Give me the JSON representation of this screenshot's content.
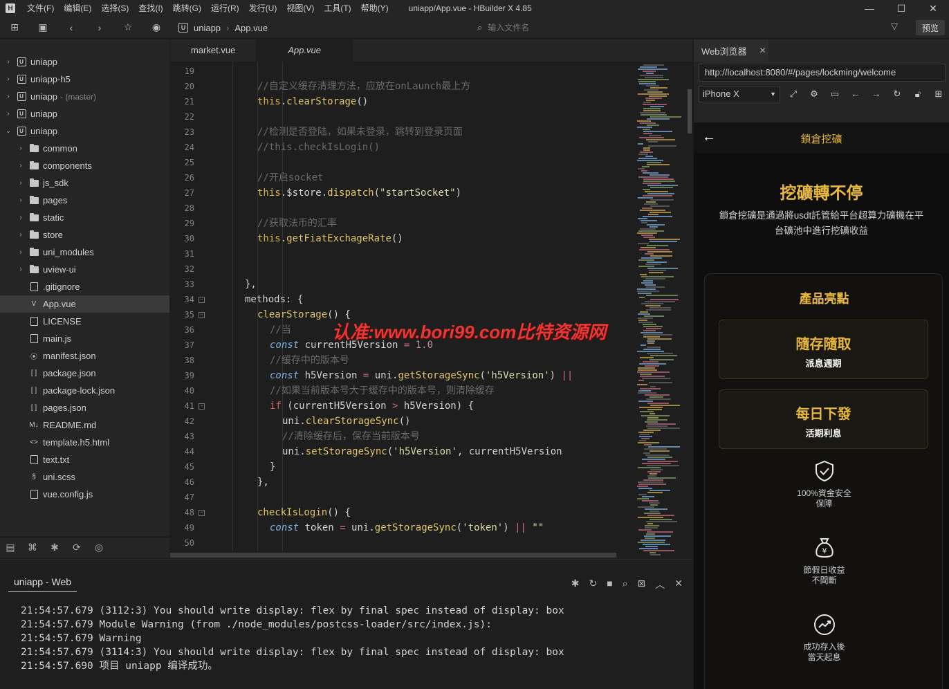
{
  "titlebar": {
    "menus": [
      "文件(F)",
      "编辑(E)",
      "选择(S)",
      "查找(I)",
      "跳转(G)",
      "运行(R)",
      "发行(U)",
      "视图(V)",
      "工具(T)",
      "帮助(Y)"
    ],
    "title": "uniapp/App.vue - HBuilder X 4.85"
  },
  "toolbar": {
    "breadcrumb": [
      "uniapp",
      "App.vue"
    ],
    "file_search_placeholder": "输入文件名",
    "preview_label": "预览"
  },
  "sidebar": {
    "projects": [
      {
        "name": "uniapp",
        "branch": ""
      },
      {
        "name": "uniapp-h5",
        "branch": ""
      },
      {
        "name": "uniapp",
        "branch": "- (master)"
      },
      {
        "name": "uniapp",
        "branch": ""
      },
      {
        "name": "uniapp",
        "branch": ""
      }
    ],
    "folders": [
      "common",
      "components",
      "js_sdk",
      "pages",
      "static",
      "store",
      "uni_modules",
      "uview-ui"
    ],
    "files": [
      ".gitignore",
      "App.vue",
      "LICENSE",
      "main.js",
      "manifest.json",
      "package.json",
      "package-lock.json",
      "pages.json",
      "README.md",
      "template.h5.html",
      "text.txt",
      "uni.scss",
      "vue.config.js"
    ],
    "selected_file": "App.vue"
  },
  "editor": {
    "tabs": [
      "market.vue",
      "App.vue"
    ],
    "active_tab": "App.vue",
    "first_line_number": 19,
    "lines": [
      {
        "indent": 0,
        "tokens": []
      },
      {
        "indent": 4,
        "tokens": [
          {
            "t": "//自定义缓存清理方法，应放在onLaunch最上方",
            "c": "c-comment"
          }
        ]
      },
      {
        "indent": 4,
        "tokens": [
          {
            "t": "this",
            "c": "c-this"
          },
          {
            "t": ".",
            "c": "c-plain"
          },
          {
            "t": "clearStorage",
            "c": "c-fn"
          },
          {
            "t": "()",
            "c": "c-plain"
          }
        ]
      },
      {
        "indent": 0,
        "tokens": []
      },
      {
        "indent": 4,
        "tokens": [
          {
            "t": "//检测是否登陆，如果未登录，跳转到登录页面",
            "c": "c-comment"
          }
        ]
      },
      {
        "indent": 4,
        "tokens": [
          {
            "t": "//this.checkIsLogin()",
            "c": "c-comment"
          }
        ]
      },
      {
        "indent": 0,
        "tokens": []
      },
      {
        "indent": 4,
        "tokens": [
          {
            "t": "//开启socket",
            "c": "c-comment"
          }
        ]
      },
      {
        "indent": 4,
        "tokens": [
          {
            "t": "this",
            "c": "c-this"
          },
          {
            "t": ".$store.",
            "c": "c-plain"
          },
          {
            "t": "dispatch",
            "c": "c-fn"
          },
          {
            "t": "(",
            "c": "c-plain"
          },
          {
            "t": "\"startSocket\"",
            "c": "c-str"
          },
          {
            "t": ")",
            "c": "c-plain"
          }
        ]
      },
      {
        "indent": 0,
        "tokens": []
      },
      {
        "indent": 4,
        "tokens": [
          {
            "t": "//获取法币的汇率",
            "c": "c-comment"
          }
        ]
      },
      {
        "indent": 4,
        "tokens": [
          {
            "t": "this",
            "c": "c-this"
          },
          {
            "t": ".",
            "c": "c-plain"
          },
          {
            "t": "getFiatExchageRate",
            "c": "c-fn"
          },
          {
            "t": "()",
            "c": "c-plain"
          }
        ]
      },
      {
        "indent": 0,
        "tokens": []
      },
      {
        "indent": 0,
        "tokens": []
      },
      {
        "indent": 2,
        "tokens": [
          {
            "t": "},",
            "c": "c-plain"
          }
        ]
      },
      {
        "indent": 2,
        "fold": true,
        "tokens": [
          {
            "t": "methods: {",
            "c": "c-plain"
          }
        ]
      },
      {
        "indent": 4,
        "fold": true,
        "tokens": [
          {
            "t": "clearStorage",
            "c": "c-fn"
          },
          {
            "t": "() {",
            "c": "c-plain"
          }
        ]
      },
      {
        "indent": 6,
        "tokens": [
          {
            "t": "//当",
            "c": "c-comment"
          }
        ]
      },
      {
        "indent": 6,
        "tokens": [
          {
            "t": "const",
            "c": "c-kw"
          },
          {
            "t": " currentH5Version ",
            "c": "c-plain"
          },
          {
            "t": "=",
            "c": "c-op"
          },
          {
            "t": " ",
            "c": "c-plain"
          },
          {
            "t": "1.0",
            "c": "c-num"
          }
        ]
      },
      {
        "indent": 6,
        "tokens": [
          {
            "t": "//缓存中的版本号",
            "c": "c-comment"
          }
        ]
      },
      {
        "indent": 6,
        "tokens": [
          {
            "t": "const",
            "c": "c-kw"
          },
          {
            "t": " h5Version ",
            "c": "c-plain"
          },
          {
            "t": "=",
            "c": "c-op"
          },
          {
            "t": " uni.",
            "c": "c-plain"
          },
          {
            "t": "getStorageSync",
            "c": "c-fn"
          },
          {
            "t": "(",
            "c": "c-plain"
          },
          {
            "t": "'h5Version'",
            "c": "c-str"
          },
          {
            "t": ") ",
            "c": "c-plain"
          },
          {
            "t": "||",
            "c": "c-op"
          }
        ]
      },
      {
        "indent": 6,
        "tokens": [
          {
            "t": "//如果当前版本号大于缓存中的版本号，则清除缓存",
            "c": "c-comment"
          }
        ]
      },
      {
        "indent": 6,
        "fold": true,
        "tokens": [
          {
            "t": "if",
            "c": "c-if"
          },
          {
            "t": " (currentH5Version ",
            "c": "c-plain"
          },
          {
            "t": ">",
            "c": "c-op"
          },
          {
            "t": " h5Version) {",
            "c": "c-plain"
          }
        ]
      },
      {
        "indent": 8,
        "tokens": [
          {
            "t": "uni.",
            "c": "c-plain"
          },
          {
            "t": "clearStorageSync",
            "c": "c-fn"
          },
          {
            "t": "()",
            "c": "c-plain"
          }
        ]
      },
      {
        "indent": 8,
        "tokens": [
          {
            "t": "//清除缓存后，保存当前版本号",
            "c": "c-comment"
          }
        ]
      },
      {
        "indent": 8,
        "tokens": [
          {
            "t": "uni.",
            "c": "c-plain"
          },
          {
            "t": "setStorageSync",
            "c": "c-fn"
          },
          {
            "t": "(",
            "c": "c-plain"
          },
          {
            "t": "'h5Version'",
            "c": "c-str"
          },
          {
            "t": ", currentH5Version",
            "c": "c-plain"
          }
        ]
      },
      {
        "indent": 6,
        "tokens": [
          {
            "t": "}",
            "c": "c-plain"
          }
        ]
      },
      {
        "indent": 4,
        "tokens": [
          {
            "t": "},",
            "c": "c-plain"
          }
        ]
      },
      {
        "indent": 0,
        "tokens": []
      },
      {
        "indent": 4,
        "fold": true,
        "tokens": [
          {
            "t": "checkIsLogin",
            "c": "c-fn"
          },
          {
            "t": "() {",
            "c": "c-plain"
          }
        ]
      },
      {
        "indent": 6,
        "tokens": [
          {
            "t": "const",
            "c": "c-kw"
          },
          {
            "t": " token ",
            "c": "c-plain"
          },
          {
            "t": "=",
            "c": "c-op"
          },
          {
            "t": " uni.",
            "c": "c-plain"
          },
          {
            "t": "getStorageSync",
            "c": "c-fn"
          },
          {
            "t": "(",
            "c": "c-plain"
          },
          {
            "t": "'token'",
            "c": "c-str"
          },
          {
            "t": ") ",
            "c": "c-plain"
          },
          {
            "t": "||",
            "c": "c-op"
          },
          {
            "t": " ",
            "c": "c-plain"
          },
          {
            "t": "\"\"",
            "c": "c-str"
          }
        ]
      },
      {
        "indent": 0,
        "tokens": []
      }
    ],
    "watermark": "认准:www.bori99.com比特资源网"
  },
  "console": {
    "tab": "uniapp - Web",
    "lines": [
      "21:54:57.679 (3112:3) You should write display: flex by final spec instead of display: box",
      "21:54:57.679 Module Warning (from ./node_modules/postcss-loader/src/index.js):",
      "21:54:57.679 Warning",
      "21:54:57.679 (3114:3) You should write display: flex by final spec instead of display: box",
      "21:54:57.690 项目 uniapp 编译成功。"
    ]
  },
  "browser": {
    "tab": "Web浏览器",
    "url": "http://localhost:8080/#/pages/lockming/welcome",
    "device": "iPhone X"
  },
  "phone": {
    "nav_title": "鎖倉挖礦",
    "hero_title": "挖礦轉不停",
    "hero_desc": "鎖倉挖礦是通過將usdt託管給平台超算力礦機在平台礦池中進行挖礦收益",
    "features_title": "產品亮點",
    "products": [
      {
        "title": "隨存隨取",
        "sub": "派息週期"
      },
      {
        "title": "每日下發",
        "sub": "活期利息"
      }
    ],
    "benefits": [
      {
        "icon": "shield-check-icon",
        "line1": "100%資金安全",
        "line2": "保障"
      },
      {
        "icon": "money-bag-icon",
        "line1": "節假日收益",
        "line2": "不間斷"
      },
      {
        "icon": "trend-up-icon",
        "line1": "成功存入後",
        "line2": "當天起息"
      }
    ],
    "accent": "#e8b83e"
  }
}
